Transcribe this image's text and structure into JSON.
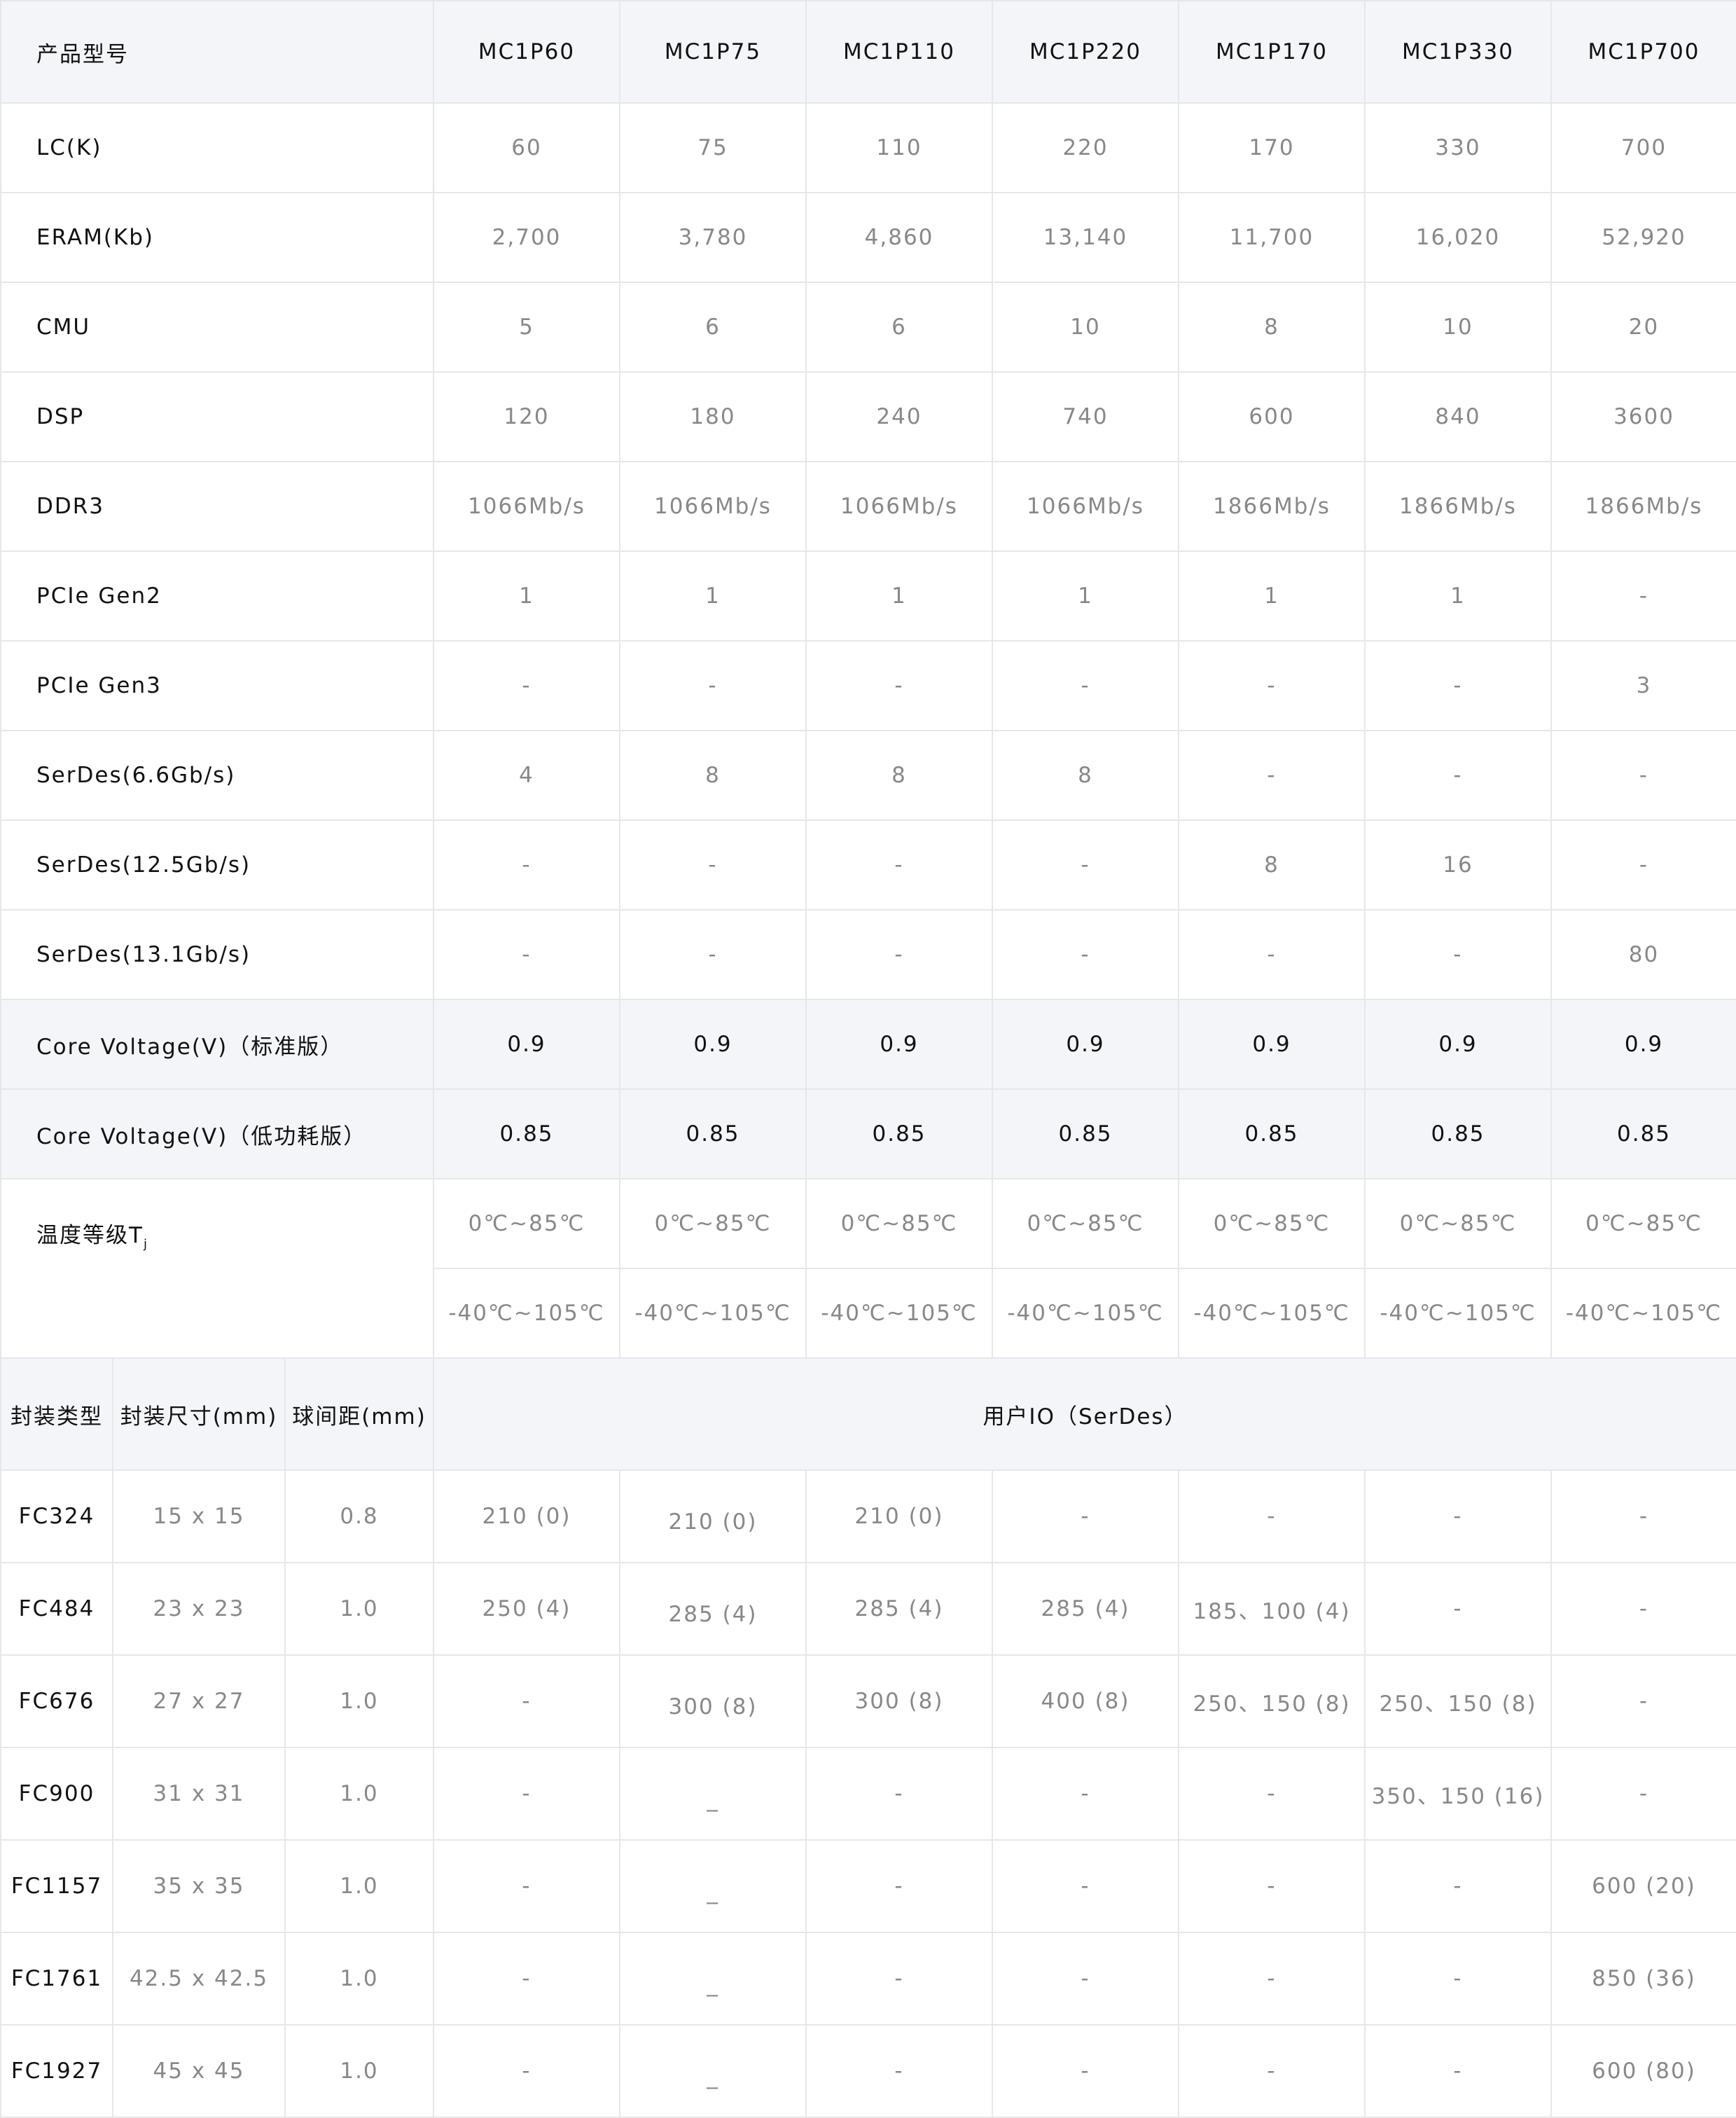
{
  "spec_table": {
    "header": {
      "label": "产品型号",
      "models": [
        "MC1P60",
        "MC1P75",
        "MC1P110",
        "MC1P220",
        "MC1P170",
        "MC1P330",
        "MC1P700"
      ]
    },
    "rows": [
      {
        "label": "LC(K)",
        "values": [
          "60",
          "75",
          "110",
          "220",
          "170",
          "330",
          "700"
        ]
      },
      {
        "label": "ERAM(Kb)",
        "values": [
          "2,700",
          "3,780",
          "4,860",
          "13,140",
          "11,700",
          "16,020",
          "52,920"
        ]
      },
      {
        "label": "CMU",
        "values": [
          "5",
          "6",
          "6",
          "10",
          "8",
          "10",
          "20"
        ]
      },
      {
        "label": "DSP",
        "values": [
          "120",
          "180",
          "240",
          "740",
          "600",
          "840",
          "3600"
        ]
      },
      {
        "label": "DDR3",
        "values": [
          "1066Mb/s",
          "1066Mb/s",
          "1066Mb/s",
          "1066Mb/s",
          "1866Mb/s",
          "1866Mb/s",
          "1866Mb/s"
        ]
      },
      {
        "label": "PCIe Gen2",
        "values": [
          "1",
          "1",
          "1",
          "1",
          "1",
          "1",
          "-"
        ]
      },
      {
        "label": "PCIe Gen3",
        "values": [
          "-",
          "-",
          "-",
          "-",
          "-",
          "-",
          "3"
        ]
      },
      {
        "label": "SerDes(6.6Gb/s)",
        "values": [
          "4",
          "8",
          "8",
          "8",
          "-",
          "-",
          "-"
        ]
      },
      {
        "label": "SerDes(12.5Gb/s)",
        "values": [
          "-",
          "-",
          "-",
          "-",
          "8",
          "16",
          "-"
        ]
      },
      {
        "label": "SerDes(13.1Gb/s)",
        "values": [
          "-",
          "-",
          "-",
          "-",
          "-",
          "-",
          "80"
        ]
      }
    ],
    "voltage_rows": [
      {
        "label": "Core Voltage(V)（标准版）",
        "values": [
          "0.9",
          "0.9",
          "0.9",
          "0.9",
          "0.9",
          "0.9",
          "0.9"
        ]
      },
      {
        "label": "Core Voltage(V)（低功耗版）",
        "values": [
          "0.85",
          "0.85",
          "0.85",
          "0.85",
          "0.85",
          "0.85",
          "0.85"
        ]
      }
    ],
    "temperature": {
      "label": "温度等级T",
      "label_sub": "j",
      "commercial": [
        "0℃~85℃",
        "0℃~85℃",
        "0℃~85℃",
        "0℃~85℃",
        "0℃~85℃",
        "0℃~85℃",
        "0℃~85℃"
      ],
      "industrial": [
        "-40℃~105℃",
        "-40℃~105℃",
        "-40℃~105℃",
        "-40℃~105℃",
        "-40℃~105℃",
        "-40℃~105℃",
        "-40℃~105℃"
      ]
    }
  },
  "package_table": {
    "headers": {
      "type": "封装类型",
      "size": "封装尺寸(mm)",
      "pitch": "球间距(mm)",
      "user_io": "用户IO（SerDes）"
    },
    "rows": [
      {
        "type": "FC324",
        "size": "15 x 15",
        "pitch": "0.8",
        "io": [
          "210 (0)",
          "210 (0)",
          "210 (0)",
          "-",
          "-",
          "-",
          "-"
        ]
      },
      {
        "type": "FC484",
        "size": "23 x 23",
        "pitch": "1.0",
        "io": [
          "250 (4)",
          "285 (4)",
          "285 (4)",
          "285 (4)",
          "185、100 (4)",
          "-",
          "-"
        ]
      },
      {
        "type": "FC676",
        "size": "27 x 27",
        "pitch": "1.0",
        "io": [
          "-",
          "300 (8)",
          "300 (8)",
          "400 (8)",
          "250、150 (8)",
          "250、150 (8)",
          "-"
        ]
      },
      {
        "type": "FC900",
        "size": "31 x 31",
        "pitch": "1.0",
        "io": [
          "-",
          "_",
          "-",
          "-",
          "-",
          "350、150 (16)",
          "-"
        ]
      },
      {
        "type": "FC1157",
        "size": "35 x 35",
        "pitch": "1.0",
        "io": [
          "-",
          "_",
          "-",
          "-",
          "-",
          "-",
          "600 (20)"
        ]
      },
      {
        "type": "FC1761",
        "size": "42.5 x 42.5",
        "pitch": "1.0",
        "io": [
          "-",
          "_",
          "-",
          "-",
          "-",
          "-",
          "850 (36)"
        ]
      },
      {
        "type": "FC1927",
        "size": "45 x 45",
        "pitch": "1.0",
        "io": [
          "-",
          "_",
          "-",
          "-",
          "-",
          "-",
          "600 (80)"
        ]
      }
    ]
  }
}
